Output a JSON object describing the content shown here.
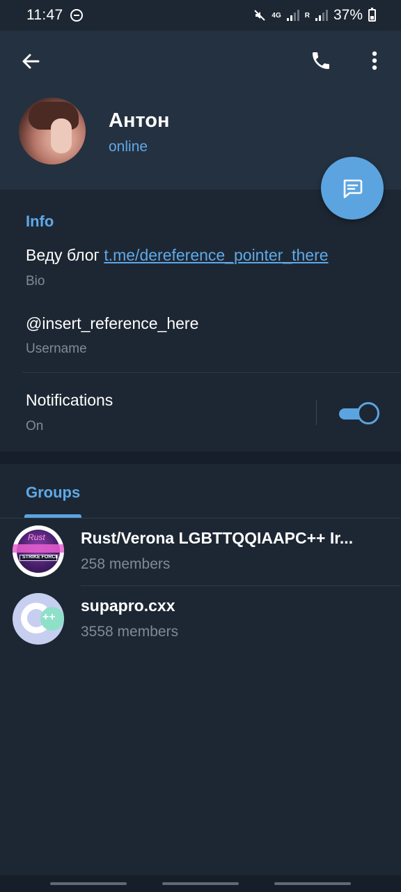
{
  "status_bar": {
    "time": "11:47",
    "network_top": "4G",
    "roaming": "R",
    "battery": "37%"
  },
  "header": {
    "name": "Антон",
    "status": "online"
  },
  "info": {
    "title": "Info",
    "bio_text": "Веду блог ",
    "bio_link": "t.me/dereference_pointer_there",
    "bio_caption": "Bio",
    "username": "@insert_reference_here",
    "username_caption": "Username",
    "notifications_label": "Notifications",
    "notifications_value": "On",
    "notifications_enabled": true
  },
  "groups": {
    "tab_label": "Groups",
    "items": [
      {
        "name": "Rust/Verona LGBTTQQIAAPC++ Ir...",
        "members": "258 members",
        "avatar_text": "Rust",
        "avatar_subtext": "STRIKE FORCE"
      },
      {
        "name": "supapro.cxx",
        "members": "3558 members",
        "avatar_text": "++"
      }
    ]
  },
  "colors": {
    "accent": "#5ba4e0",
    "background": "#1d2733",
    "header_background": "#243140",
    "secondary_text": "#7e8b97"
  },
  "icons": {
    "back": "arrow-left-icon",
    "call": "phone-icon",
    "more": "more-vertical-icon",
    "message": "message-icon"
  }
}
